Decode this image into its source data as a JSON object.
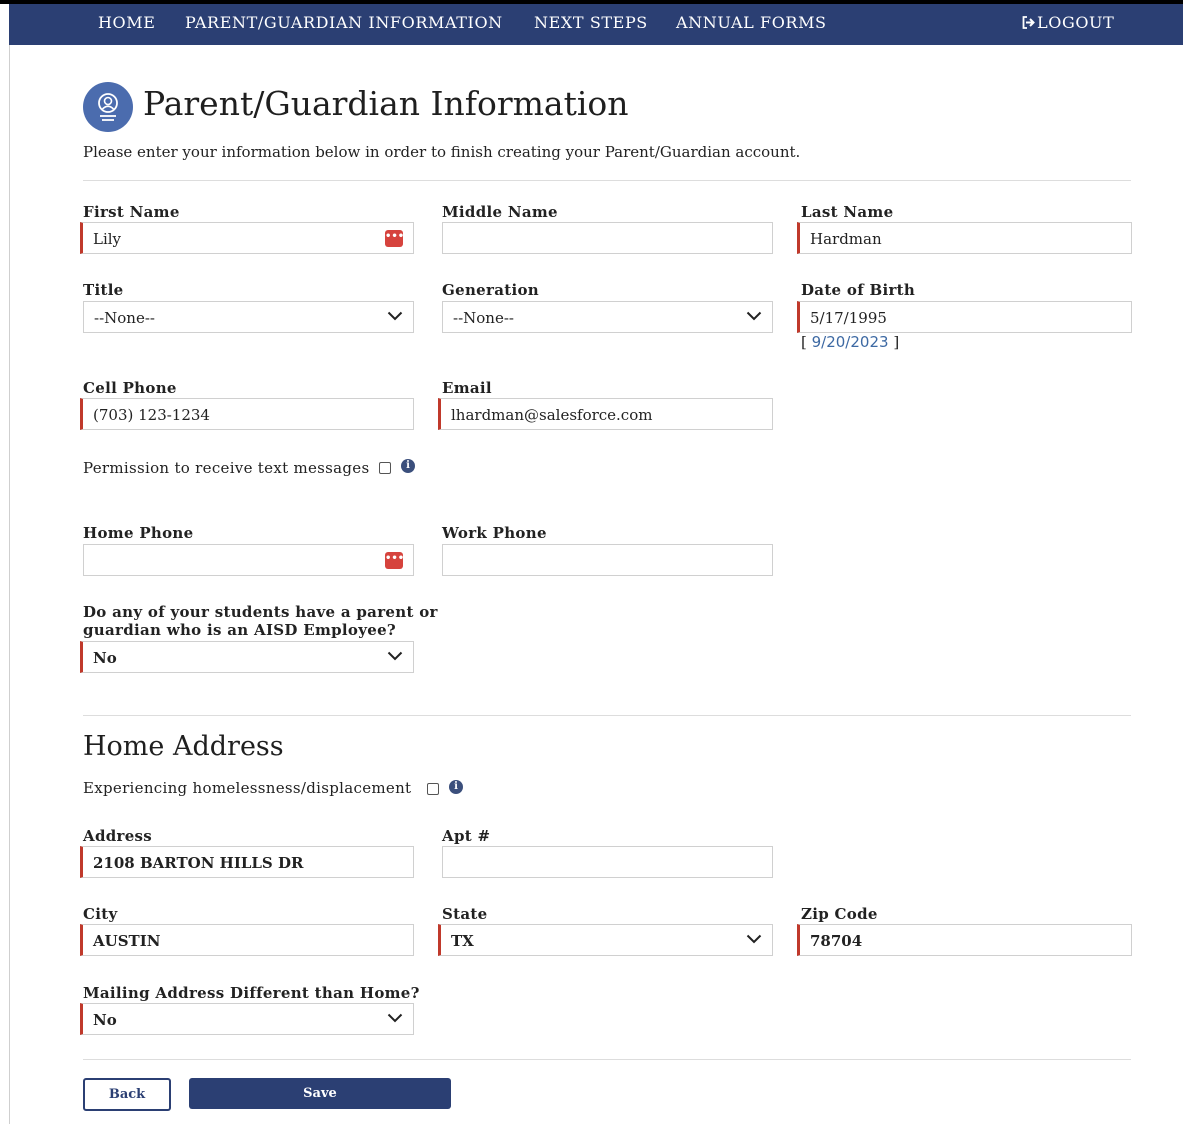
{
  "nav": {
    "home": "HOME",
    "parent_info": "PARENT/GUARDIAN INFORMATION",
    "next_steps": "NEXT STEPS",
    "annual_forms": "ANNUAL FORMS",
    "logout": "LOGOUT"
  },
  "page": {
    "title": "Parent/Guardian Information",
    "intro": "Please enter your information below in order to finish creating your Parent/Guardian account."
  },
  "fields": {
    "first_name": {
      "label": "First Name",
      "value": "Lily"
    },
    "middle_name": {
      "label": "Middle Name",
      "value": ""
    },
    "last_name": {
      "label": "Last Name",
      "value": "Hardman"
    },
    "title": {
      "label": "Title",
      "value": "--None--"
    },
    "generation": {
      "label": "Generation",
      "value": "--None--"
    },
    "dob": {
      "label": "Date of Birth",
      "value": "5/17/1995",
      "today_link": "9/20/2023"
    },
    "cell_phone": {
      "label": "Cell Phone",
      "value": "(703) 123-1234"
    },
    "email": {
      "label": "Email",
      "value": "lhardman@salesforce.com"
    },
    "text_permission": {
      "label": "Permission to receive text messages"
    },
    "home_phone": {
      "label": "Home Phone",
      "value": ""
    },
    "work_phone": {
      "label": "Work Phone",
      "value": ""
    },
    "aisd_employee": {
      "label_line1": "Do any of your students have a parent or",
      "label_line2": "guardian who is an AISD Employee?",
      "value": "No"
    }
  },
  "address": {
    "section_title": "Home Address",
    "homeless_label": "Experiencing homelessness/displacement",
    "address": {
      "label": "Address",
      "value": "2108 BARTON HILLS DR"
    },
    "apt": {
      "label": "Apt #",
      "value": ""
    },
    "city": {
      "label": "City",
      "value": "AUSTIN"
    },
    "state": {
      "label": "State",
      "value": "TX"
    },
    "zip": {
      "label": "Zip Code",
      "value": "78704"
    },
    "mailing_diff": {
      "label": "Mailing Address Different than Home?",
      "value": "No"
    }
  },
  "buttons": {
    "back": "Back",
    "save": "Save"
  },
  "colors": {
    "nav_bg": "#2b3f73",
    "required": "#c0392b",
    "link": "#3d69a3",
    "icon_bg": "#4b6cae"
  }
}
